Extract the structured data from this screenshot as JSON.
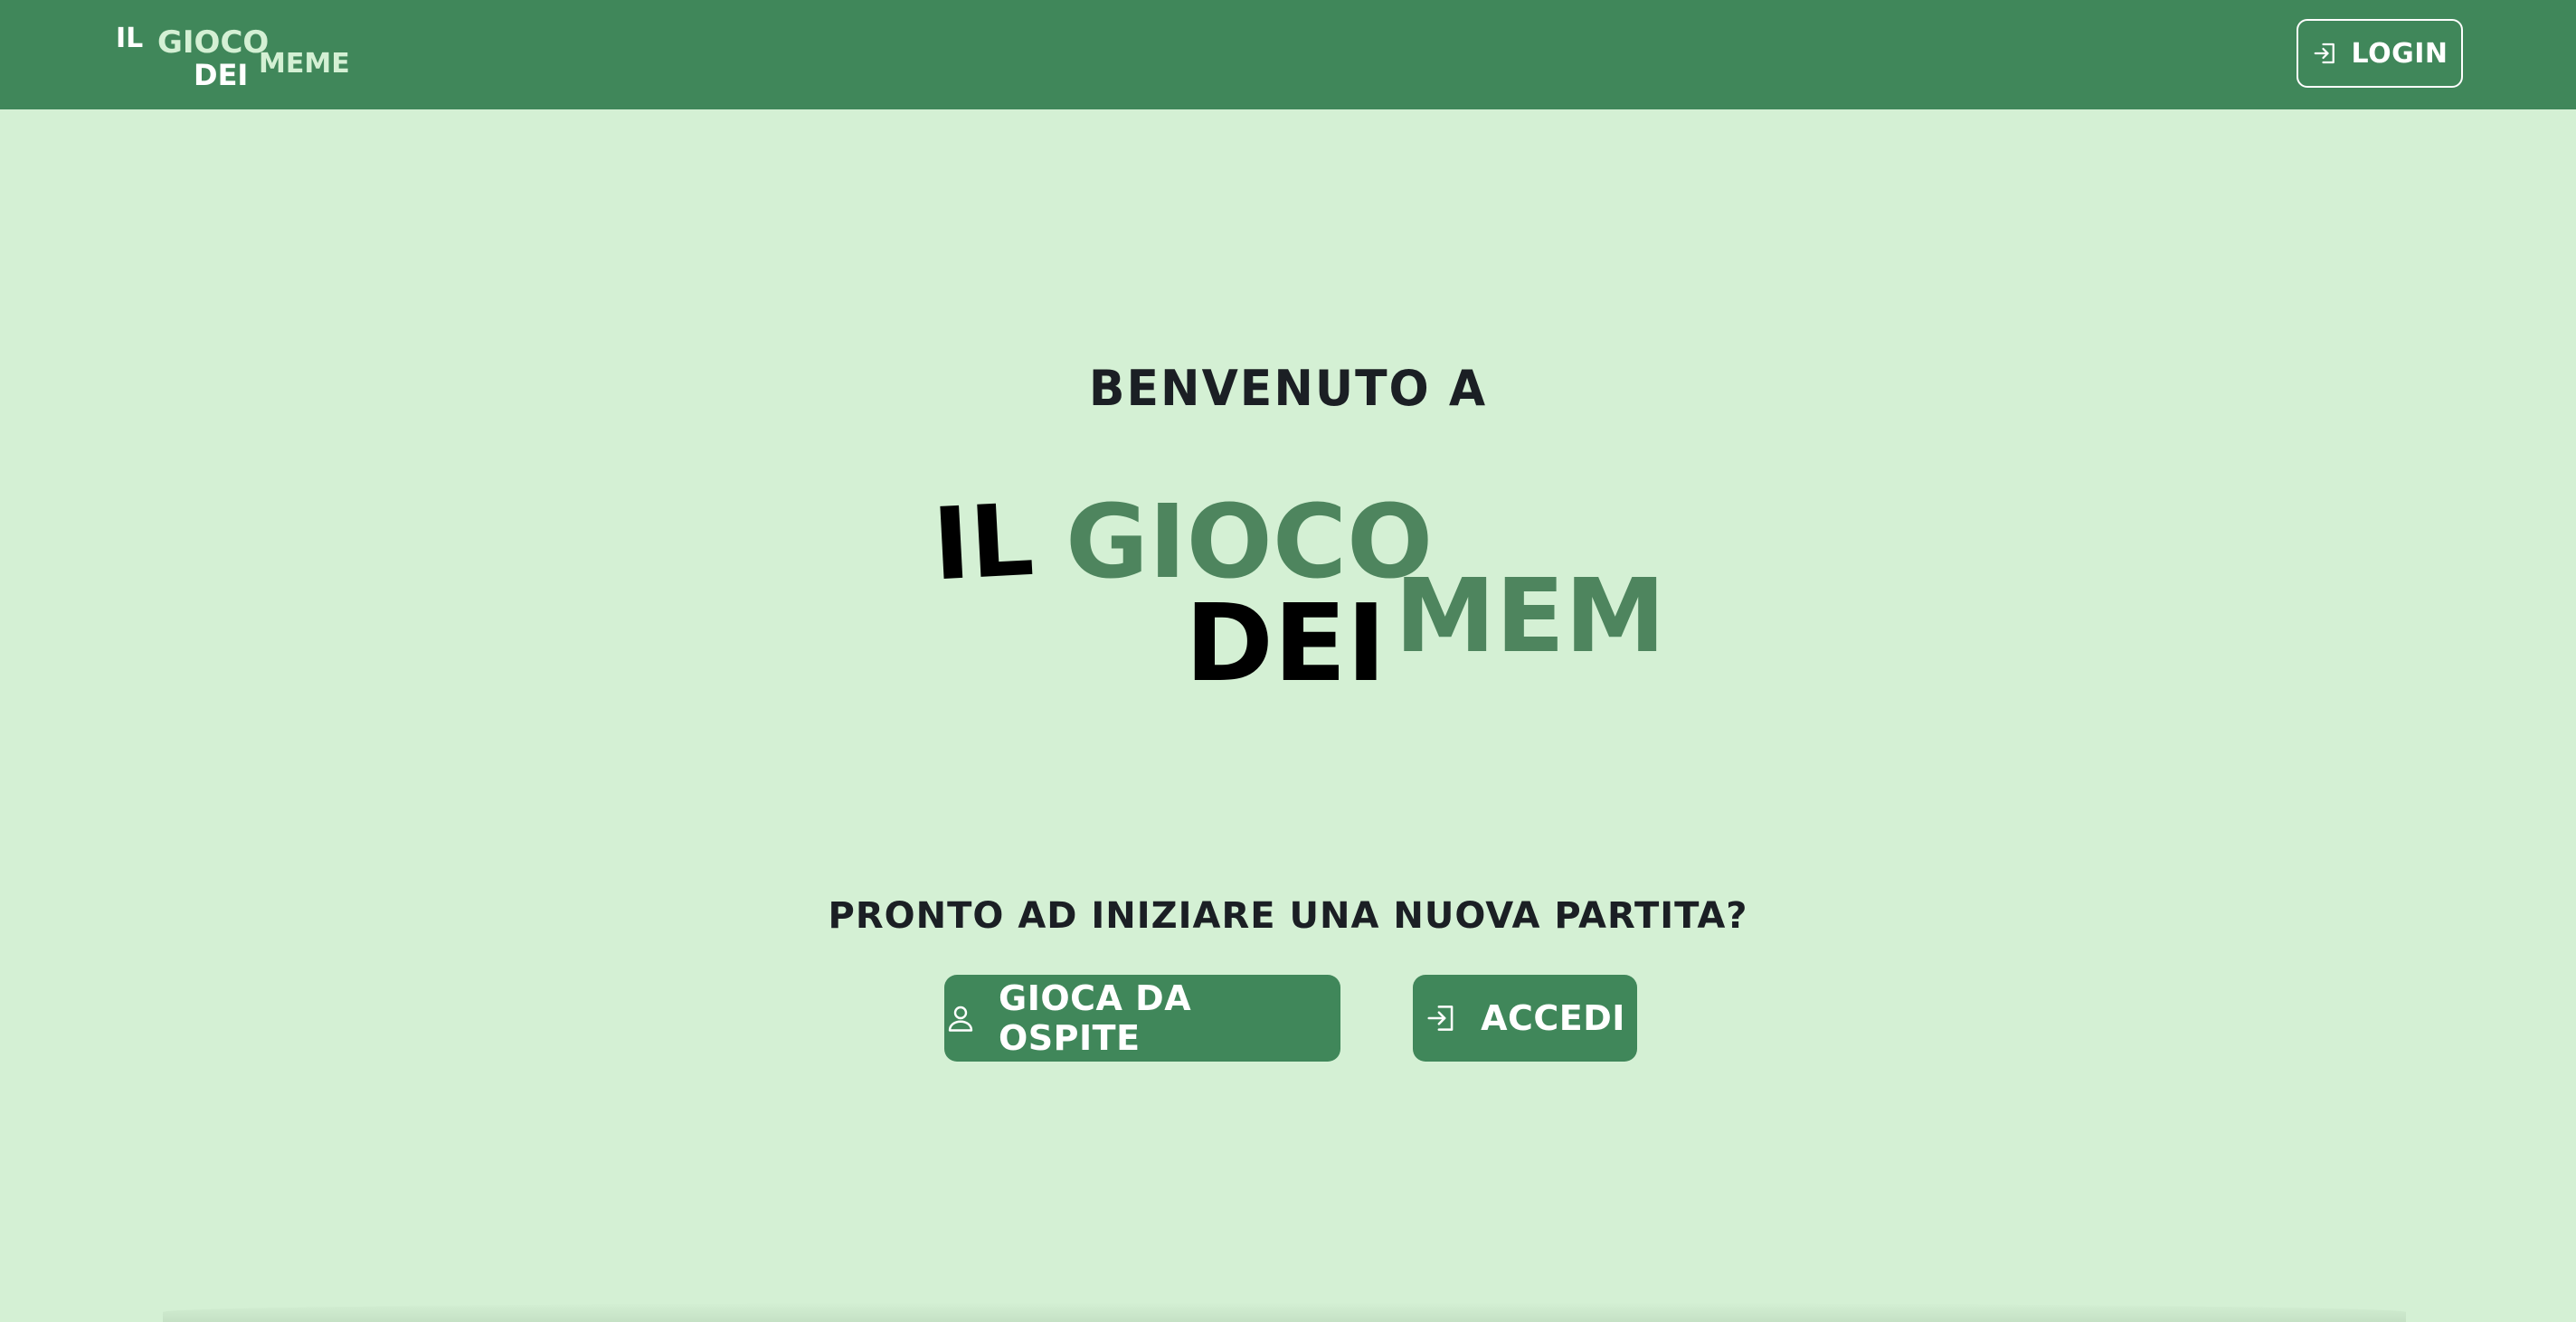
{
  "navbar": {
    "logo_words": [
      "IL",
      "GIOCO",
      "DEI",
      "MEME"
    ],
    "login_label": "LOGIN",
    "login_icon": "login-icon",
    "background": "#40875a"
  },
  "main": {
    "welcome": "BENVENUTO A",
    "logo_words": [
      "IL",
      "GIOCO",
      "DEI",
      "MEME"
    ],
    "question": "PRONTO AD INIZIARE UNA NUOVA PARTITA?",
    "guest_button": {
      "label": "GIOCA DA OSPITE",
      "icon": "user-icon"
    },
    "accedi_button": {
      "label": "ACCEDI",
      "icon": "login-icon"
    }
  },
  "colors": {
    "page_background": "#d4f0d4",
    "accent": "#40875a",
    "logo_green": "#4e855e",
    "logo_dark": "#000000",
    "nav_logo_light": "#ffffff",
    "nav_logo_mint": "#d4f0d4",
    "text_dark": "#1b1f24"
  }
}
